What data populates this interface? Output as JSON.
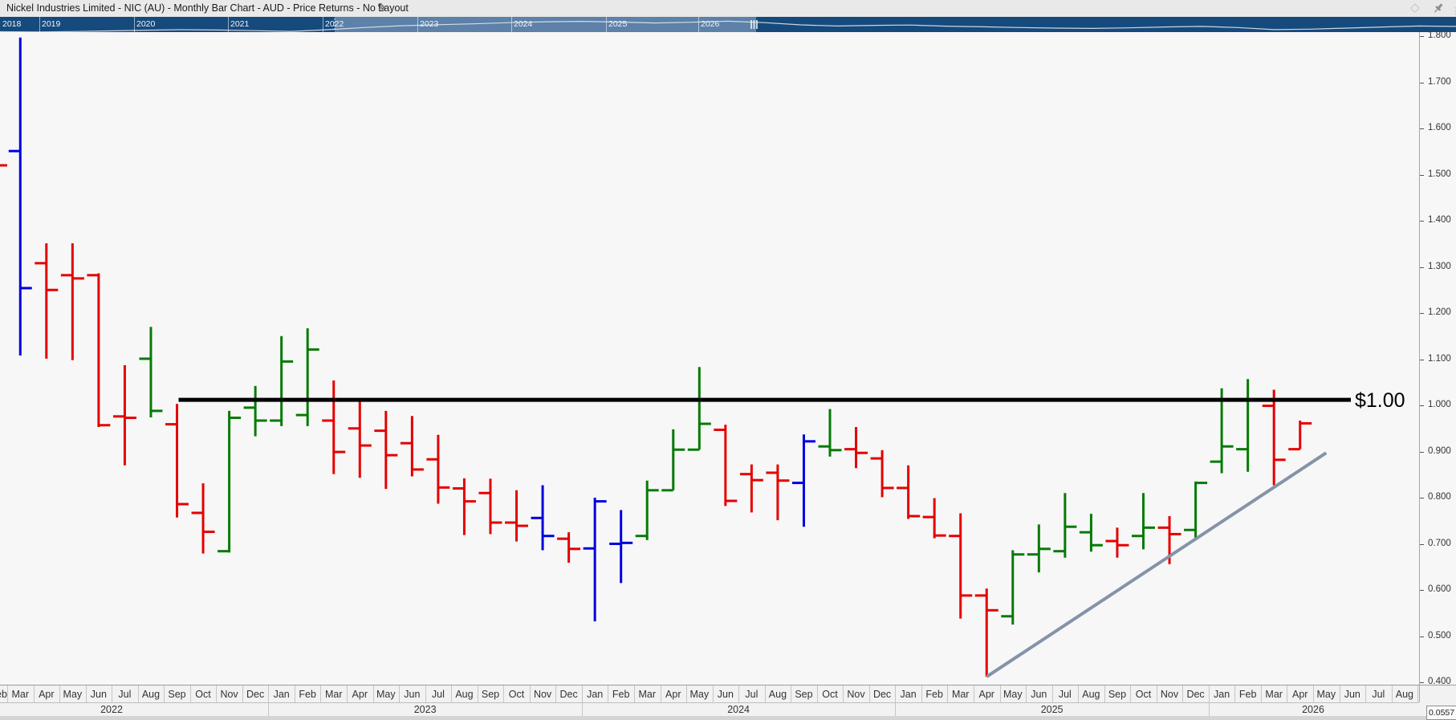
{
  "title": "Nickel Industries Limited - NIC (AU) - Monthly Bar Chart - AUD - Price Returns - No Layout",
  "titlebar_icons": {
    "edit": "pencil-icon",
    "diamond": "diamond-icon",
    "pin": "pushpin-icon"
  },
  "corner_value": "0.0557",
  "navigator": {
    "years": [
      "2018",
      "2019",
      "2020",
      "2021",
      "2022",
      "2023",
      "2024",
      "2025",
      "2026"
    ],
    "selection": {
      "start_label": "2022",
      "end_label": "2026"
    },
    "sparkline": [
      0.33,
      0.3,
      0.34,
      0.42,
      0.5,
      0.55,
      0.52,
      0.44,
      0.36,
      0.55,
      0.8,
      1.0,
      1.12,
      1.22,
      1.35,
      1.45,
      1.5,
      1.42,
      1.32,
      1.4,
      1.52,
      1.35,
      1.1,
      0.97,
      1.04,
      1.08,
      0.95,
      0.88,
      0.8,
      0.73,
      0.7,
      0.76,
      0.86,
      0.93,
      0.8,
      0.56,
      0.62,
      0.73,
      0.86,
      0.97,
      0.93
    ]
  },
  "chart_data": {
    "type": "ohlc_bar",
    "title": "Nickel Industries Limited - NIC (AU) Monthly Bar Chart (AUD, Price Returns)",
    "ylim": [
      0.4,
      1.8
    ],
    "grid": false,
    "y_ticks": [
      {
        "v": 1.8,
        "label": "1.800"
      },
      {
        "v": 1.7,
        "label": "1.700"
      },
      {
        "v": 1.6,
        "label": "1.600"
      },
      {
        "v": 1.5,
        "label": "1.500"
      },
      {
        "v": 1.4,
        "label": "1.400"
      },
      {
        "v": 1.3,
        "label": "1.300"
      },
      {
        "v": 1.2,
        "label": "1.200"
      },
      {
        "v": 1.1,
        "label": "1.100"
      },
      {
        "v": 1.0,
        "label": "1.000"
      },
      {
        "v": 0.9,
        "label": "0.900"
      },
      {
        "v": 0.8,
        "label": "0.800"
      },
      {
        "v": 0.7,
        "label": "0.700"
      },
      {
        "v": 0.6,
        "label": "0.600"
      },
      {
        "v": 0.5,
        "label": "0.500"
      },
      {
        "v": 0.4,
        "label": "0.400"
      }
    ],
    "month_labels": [
      "Feb",
      "Mar",
      "Apr",
      "May",
      "Jun",
      "Jul",
      "Aug",
      "Sep",
      "Oct",
      "Nov",
      "Dec",
      "Jan",
      "Feb",
      "Mar",
      "Apr",
      "May",
      "Jun",
      "Jul",
      "Aug",
      "Sep",
      "Oct",
      "Nov",
      "Dec",
      "Jan",
      "Feb",
      "Mar",
      "Apr",
      "May",
      "Jun",
      "Jul",
      "Aug",
      "Sep",
      "Oct",
      "Nov",
      "Dec",
      "Jan",
      "Feb",
      "Mar",
      "Apr",
      "May",
      "Jun",
      "Jul",
      "Aug",
      "Sep",
      "Oct",
      "Nov",
      "Dec",
      "Jan",
      "Feb",
      "Mar",
      "Apr",
      "May",
      "Jun",
      "Jul",
      "Aug"
    ],
    "years": [
      {
        "label": "2022",
        "months": 10
      },
      {
        "label": "2023",
        "months": 12
      },
      {
        "label": "2024",
        "months": 12
      },
      {
        "label": "2025",
        "months": 12
      },
      {
        "label": "2026",
        "months": 8
      }
    ],
    "partial_first_bar": {
      "month": "Feb 2022",
      "close_tick": 1.52,
      "color": "red"
    },
    "bars": [
      {
        "m": "Mar",
        "y": 2022,
        "col": "blue",
        "o": 1.551,
        "h": 1.797,
        "l": 1.108,
        "c": 1.254
      },
      {
        "m": "Apr",
        "y": 2022,
        "col": "red",
        "o": 1.308,
        "h": 1.351,
        "l": 1.101,
        "c": 1.25
      },
      {
        "m": "May",
        "y": 2022,
        "col": "red",
        "o": 1.282,
        "h": 1.351,
        "l": 1.098,
        "c": 1.275
      },
      {
        "m": "Jun",
        "y": 2022,
        "col": "red",
        "o": 1.282,
        "h": 1.286,
        "l": 0.953,
        "c": 0.957
      },
      {
        "m": "Jul",
        "y": 2022,
        "col": "red",
        "o": 0.976,
        "h": 1.087,
        "l": 0.87,
        "c": 0.973
      },
      {
        "m": "Aug",
        "y": 2022,
        "col": "green",
        "o": 1.101,
        "h": 1.17,
        "l": 0.974,
        "c": 0.988
      },
      {
        "m": "Sep",
        "y": 2022,
        "col": "red",
        "o": 0.959,
        "h": 1.003,
        "l": 0.757,
        "c": 0.786
      },
      {
        "m": "Oct",
        "y": 2022,
        "col": "red",
        "o": 0.767,
        "h": 0.831,
        "l": 0.679,
        "c": 0.726
      },
      {
        "m": "Nov",
        "y": 2022,
        "col": "green",
        "o": 0.684,
        "h": 0.988,
        "l": 0.681,
        "c": 0.973
      },
      {
        "m": "Dec",
        "y": 2022,
        "col": "green",
        "o": 0.995,
        "h": 1.042,
        "l": 0.933,
        "c": 0.967
      },
      {
        "m": "Jan",
        "y": 2023,
        "col": "green",
        "o": 0.967,
        "h": 1.15,
        "l": 0.955,
        "c": 1.095
      },
      {
        "m": "Feb",
        "y": 2023,
        "col": "green",
        "o": 0.979,
        "h": 1.167,
        "l": 0.955,
        "c": 1.121
      },
      {
        "m": "Mar",
        "y": 2023,
        "col": "red",
        "o": 0.967,
        "h": 1.054,
        "l": 0.851,
        "c": 0.899
      },
      {
        "m": "Apr",
        "y": 2023,
        "col": "red",
        "o": 0.95,
        "h": 1.01,
        "l": 0.843,
        "c": 0.913
      },
      {
        "m": "May",
        "y": 2023,
        "col": "red",
        "o": 0.945,
        "h": 0.988,
        "l": 0.819,
        "c": 0.892
      },
      {
        "m": "Jun",
        "y": 2023,
        "col": "red",
        "o": 0.918,
        "h": 0.977,
        "l": 0.846,
        "c": 0.861
      },
      {
        "m": "Jul",
        "y": 2023,
        "col": "red",
        "o": 0.883,
        "h": 0.936,
        "l": 0.787,
        "c": 0.822
      },
      {
        "m": "Aug",
        "y": 2023,
        "col": "red",
        "o": 0.82,
        "h": 0.842,
        "l": 0.719,
        "c": 0.792
      },
      {
        "m": "Sep",
        "y": 2023,
        "col": "red",
        "o": 0.81,
        "h": 0.841,
        "l": 0.721,
        "c": 0.746
      },
      {
        "m": "Oct",
        "y": 2023,
        "col": "red",
        "o": 0.746,
        "h": 0.816,
        "l": 0.705,
        "c": 0.739
      },
      {
        "m": "Nov",
        "y": 2023,
        "col": "blue",
        "o": 0.756,
        "h": 0.827,
        "l": 0.686,
        "c": 0.717
      },
      {
        "m": "Dec",
        "y": 2023,
        "col": "red",
        "o": 0.711,
        "h": 0.725,
        "l": 0.659,
        "c": 0.689
      },
      {
        "m": "Jan",
        "y": 2024,
        "col": "blue",
        "o": 0.69,
        "h": 0.8,
        "l": 0.532,
        "c": 0.792
      },
      {
        "m": "Feb",
        "y": 2024,
        "col": "blue",
        "o": 0.7,
        "h": 0.773,
        "l": 0.615,
        "c": 0.702
      },
      {
        "m": "Mar",
        "y": 2024,
        "col": "green",
        "o": 0.717,
        "h": 0.837,
        "l": 0.708,
        "c": 0.816
      },
      {
        "m": "Apr",
        "y": 2024,
        "col": "green",
        "o": 0.816,
        "h": 0.948,
        "l": 0.816,
        "c": 0.904
      },
      {
        "m": "May",
        "y": 2024,
        "col": "green",
        "o": 0.904,
        "h": 1.083,
        "l": 0.904,
        "c": 0.96
      },
      {
        "m": "Jun",
        "y": 2024,
        "col": "red",
        "o": 0.947,
        "h": 0.958,
        "l": 0.782,
        "c": 0.793
      },
      {
        "m": "Jul",
        "y": 2024,
        "col": "red",
        "o": 0.851,
        "h": 0.872,
        "l": 0.768,
        "c": 0.838
      },
      {
        "m": "Aug",
        "y": 2024,
        "col": "red",
        "o": 0.854,
        "h": 0.872,
        "l": 0.751,
        "c": 0.837
      },
      {
        "m": "Sep",
        "y": 2024,
        "col": "blue",
        "o": 0.832,
        "h": 0.937,
        "l": 0.737,
        "c": 0.922
      },
      {
        "m": "Oct",
        "y": 2024,
        "col": "green",
        "o": 0.911,
        "h": 0.992,
        "l": 0.889,
        "c": 0.903
      },
      {
        "m": "Nov",
        "y": 2024,
        "col": "red",
        "o": 0.905,
        "h": 0.953,
        "l": 0.864,
        "c": 0.897
      },
      {
        "m": "Dec",
        "y": 2024,
        "col": "red",
        "o": 0.885,
        "h": 0.903,
        "l": 0.801,
        "c": 0.821
      },
      {
        "m": "Jan",
        "y": 2025,
        "col": "red",
        "o": 0.821,
        "h": 0.87,
        "l": 0.754,
        "c": 0.76
      },
      {
        "m": "Feb",
        "y": 2025,
        "col": "red",
        "o": 0.758,
        "h": 0.799,
        "l": 0.712,
        "c": 0.718
      },
      {
        "m": "Mar",
        "y": 2025,
        "col": "red",
        "o": 0.717,
        "h": 0.766,
        "l": 0.538,
        "c": 0.588
      },
      {
        "m": "Apr",
        "y": 2025,
        "col": "red",
        "o": 0.588,
        "h": 0.603,
        "l": 0.412,
        "c": 0.556
      },
      {
        "m": "May",
        "y": 2025,
        "col": "green",
        "o": 0.543,
        "h": 0.686,
        "l": 0.525,
        "c": 0.677
      },
      {
        "m": "Jun",
        "y": 2025,
        "col": "green",
        "o": 0.677,
        "h": 0.742,
        "l": 0.638,
        "c": 0.689
      },
      {
        "m": "Jul",
        "y": 2025,
        "col": "green",
        "o": 0.684,
        "h": 0.81,
        "l": 0.67,
        "c": 0.737
      },
      {
        "m": "Aug",
        "y": 2025,
        "col": "green",
        "o": 0.725,
        "h": 0.765,
        "l": 0.683,
        "c": 0.697
      },
      {
        "m": "Sep",
        "y": 2025,
        "col": "red",
        "o": 0.706,
        "h": 0.735,
        "l": 0.67,
        "c": 0.697
      },
      {
        "m": "Oct",
        "y": 2025,
        "col": "green",
        "o": 0.717,
        "h": 0.81,
        "l": 0.688,
        "c": 0.735
      },
      {
        "m": "Nov",
        "y": 2025,
        "col": "red",
        "o": 0.735,
        "h": 0.76,
        "l": 0.656,
        "c": 0.721
      },
      {
        "m": "Dec",
        "y": 2025,
        "col": "green",
        "o": 0.73,
        "h": 0.835,
        "l": 0.711,
        "c": 0.832
      },
      {
        "m": "Jan",
        "y": 2026,
        "col": "green",
        "o": 0.878,
        "h": 1.037,
        "l": 0.853,
        "c": 0.911
      },
      {
        "m": "Feb",
        "y": 2026,
        "col": "green",
        "o": 0.905,
        "h": 1.057,
        "l": 0.856,
        "c": 1.011
      },
      {
        "m": "Mar",
        "y": 2026,
        "col": "red",
        "o": 0.999,
        "h": 1.034,
        "l": 0.827,
        "c": 0.882
      },
      {
        "m": "Apr",
        "y": 2026,
        "col": "red",
        "o": 0.905,
        "h": 0.967,
        "l": 0.905,
        "c": 0.961
      }
    ],
    "annotations": {
      "hline": {
        "price": 1.012,
        "label": "$1.00",
        "start_month_index": 6
      },
      "trendline": {
        "from_month_index": 37,
        "from_price": 0.412,
        "to_month_index": 50,
        "to_price": 0.897
      }
    },
    "colors": {
      "up": "#067a06",
      "down": "#e50000",
      "neutral": "#0000e0",
      "hline": "#000000",
      "trendline": "#8593a7",
      "nav_bg": "#164a7d",
      "nav_selection": "#5d81a8"
    }
  }
}
